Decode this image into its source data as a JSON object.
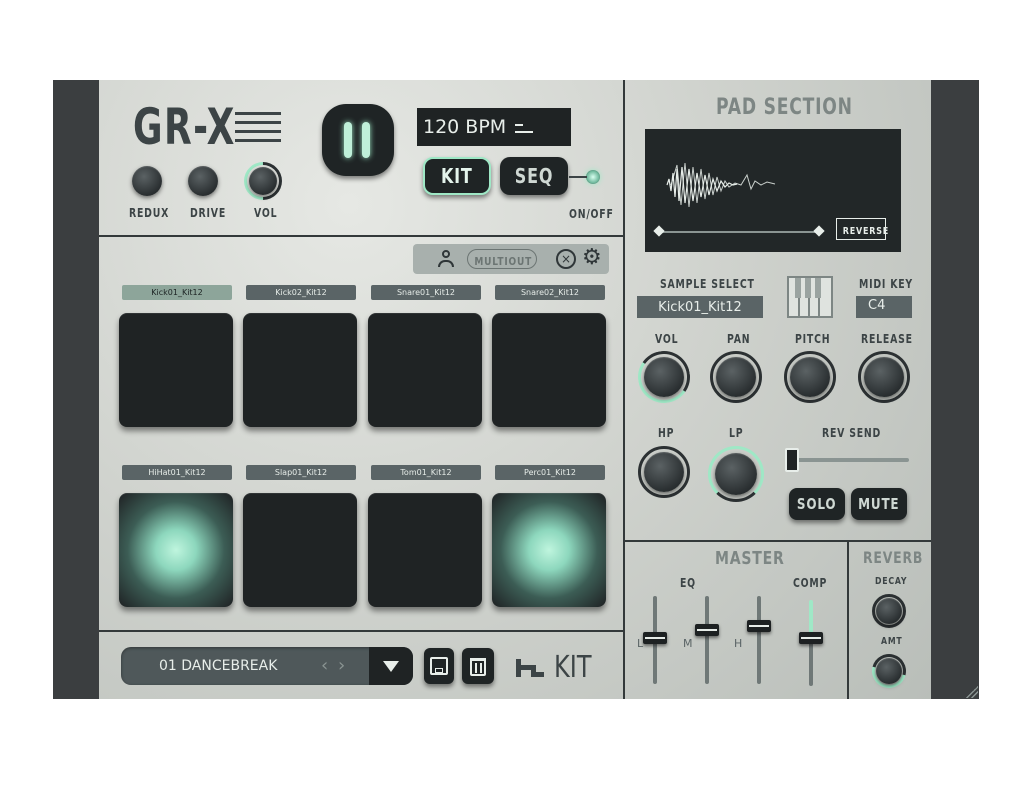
{
  "header": {
    "logo": "GR-X",
    "bpm": "120 BPM",
    "kit_label": "KIT",
    "seq_label": "SEQ",
    "onoff_label": "ON/OFF",
    "knobs": [
      "REDUX",
      "DRIVE",
      "VOL"
    ]
  },
  "toolbar": {
    "multiout_label": "MULTIOUT"
  },
  "pads": {
    "row1": [
      "Kick01_Kit12",
      "Kick02_Kit12",
      "Snare01_Kit12",
      "Snare02_Kit12"
    ],
    "row2": [
      "HiHat01_Kit12",
      "Slap01_Kit12",
      "Tom01_Kit12",
      "Perc01_Kit12"
    ]
  },
  "footer": {
    "preset_name": "01 DANCEBREAK",
    "brand_label": "KIT"
  },
  "pad_section": {
    "title": "PAD SECTION",
    "reverse_label": "REVERSE",
    "sample_select_label": "SAMPLE SELECT",
    "sample_value": "Kick01_Kit12",
    "midi_key_label": "MIDI KEY",
    "midi_key_value": "C4",
    "knob_labels_row1": [
      "VOL",
      "PAN",
      "PITCH",
      "RELEASE"
    ],
    "knob_labels_row2": [
      "HP",
      "LP"
    ],
    "rev_send_label": "REV SEND",
    "solo_label": "SOLO",
    "mute_label": "MUTE"
  },
  "master": {
    "title": "MASTER",
    "eq_label": "EQ",
    "comp_label": "COMP",
    "band_labels": [
      "L",
      "M",
      "H"
    ]
  },
  "reverb": {
    "title": "REVERB",
    "decay_label": "DECAY",
    "amt_label": "AMT"
  },
  "colors": {
    "accent": "#9fe8c6",
    "panel": "#cfd3cf",
    "dark": "#1f2324"
  },
  "icons": [
    "hamburger-icon",
    "pause-icon",
    "user-icon",
    "reset-icon",
    "gear-icon",
    "chevron-left-icon",
    "chevron-right-icon",
    "dropdown-arrow-icon",
    "save-icon",
    "trash-icon",
    "piano-icon"
  ]
}
